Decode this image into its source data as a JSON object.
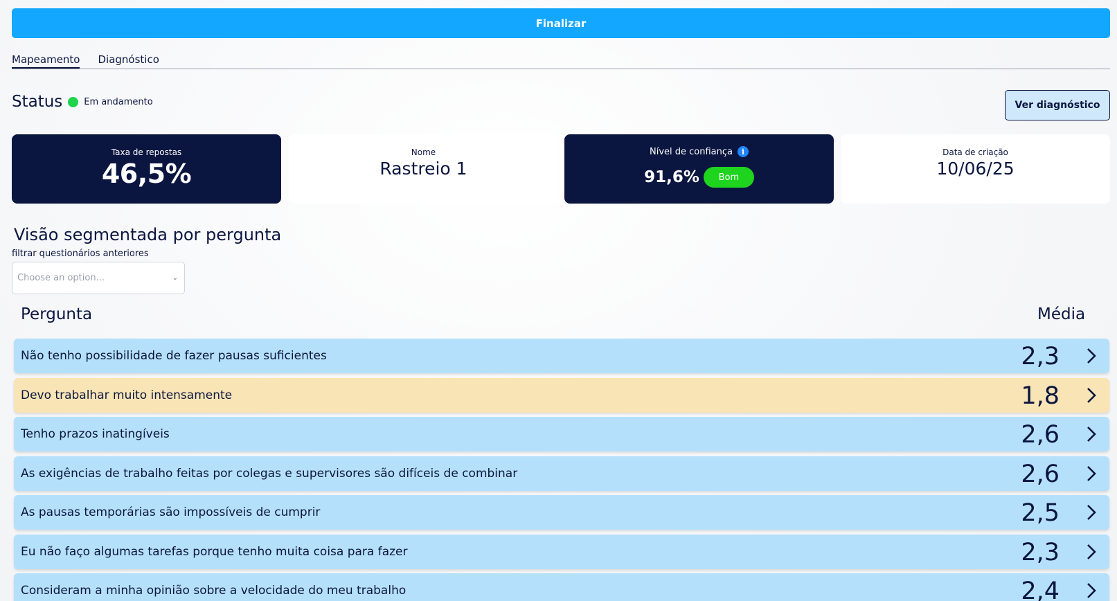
{
  "actions": {
    "finalize_label": "Finalizar",
    "view_diagnosis_label": "Ver diagnóstico"
  },
  "tabs": [
    {
      "label": "Mapeamento",
      "active": true
    },
    {
      "label": "Diagnóstico",
      "active": false
    }
  ],
  "status": {
    "title": "Status",
    "value": "Em andamento",
    "color": "#1ed44b"
  },
  "cards": {
    "response_rate": {
      "label": "Taxa de repostas",
      "value": "46,5%"
    },
    "name": {
      "label": "Nome",
      "value": "Rastreio 1"
    },
    "confidence": {
      "label": "Nível de confiança",
      "value": "91,6%",
      "badge": "Bom",
      "info_icon": "info-icon"
    },
    "created_date": {
      "label": "Data de criação",
      "value": "10/06/25"
    }
  },
  "section": {
    "title": "Visão segmentada por pergunta",
    "filter_label": "filtrar questionários anteriores",
    "filter_placeholder": "Choose an option..."
  },
  "table": {
    "headers": {
      "question": "Pergunta",
      "average": "Média"
    },
    "rows": [
      {
        "question": "Não tenho possibilidade de fazer pausas suficientes",
        "average": "2,3",
        "tone": "blue"
      },
      {
        "question": "Devo trabalhar muito intensamente",
        "average": "1,8",
        "tone": "orange"
      },
      {
        "question": "Tenho prazos inatingíveis",
        "average": "2,6",
        "tone": "blue"
      },
      {
        "question": "As exigências de trabalho feitas por colegas e supervisores são difíceis de combinar",
        "average": "2,6",
        "tone": "blue"
      },
      {
        "question": "As pausas temporárias são impossíveis de cumprir",
        "average": "2,5",
        "tone": "blue"
      },
      {
        "question": "Eu não faço algumas tarefas porque tenho muita coisa para fazer",
        "average": "2,3",
        "tone": "blue"
      },
      {
        "question": "Consideram a minha opinião sobre a velocidade do meu trabalho",
        "average": "2,4",
        "tone": "blue"
      }
    ]
  },
  "colors": {
    "primary": "#14a7ff",
    "navy": "#0a1540",
    "row_blue": "#b5e0fb",
    "row_orange": "#f9e4b5",
    "badge_green": "#1ed41e"
  }
}
